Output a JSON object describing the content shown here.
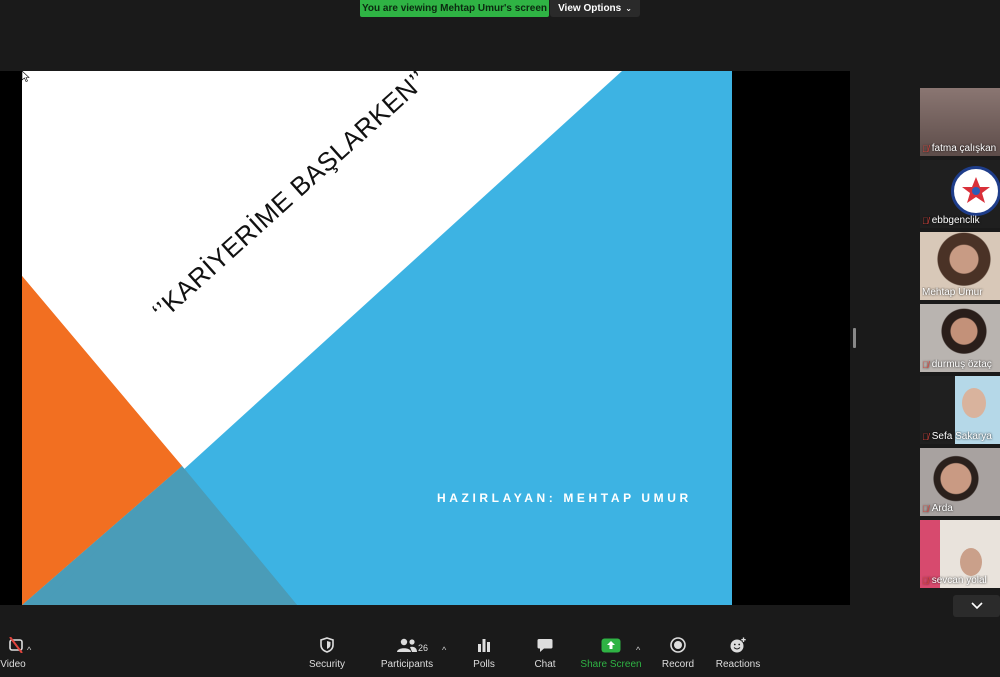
{
  "banner": {
    "text": "You are viewing Mehtap Umur's screen",
    "view_options": "View Options"
  },
  "slide": {
    "title": "‘’KARİYERİME BAŞLARKEN’’",
    "author": "HAZIRLAYAN: MEHTAP UMUR",
    "colors": {
      "blue": "#3db3e3",
      "orange": "#f26f21",
      "teal": "#4a9cb8"
    }
  },
  "participants": [
    {
      "name": "fatma çalışkan",
      "muted": true
    },
    {
      "name": "ebbgenclik",
      "muted": true
    },
    {
      "name": "Mehtap Umur",
      "muted": false,
      "active": true
    },
    {
      "name": "durmuş öztaç",
      "muted": true
    },
    {
      "name": "Sefa Sakarya",
      "muted": true
    },
    {
      "name": "Arda",
      "muted": true
    },
    {
      "name": "sevcan yolal",
      "muted": true
    }
  ],
  "toolbar": {
    "video": "Video",
    "security": "Security",
    "participants": "Participants",
    "participants_count": "26",
    "polls": "Polls",
    "chat": "Chat",
    "share_screen": "Share Screen",
    "record": "Record",
    "reactions": "Reactions",
    "accent": "#2fb344"
  }
}
